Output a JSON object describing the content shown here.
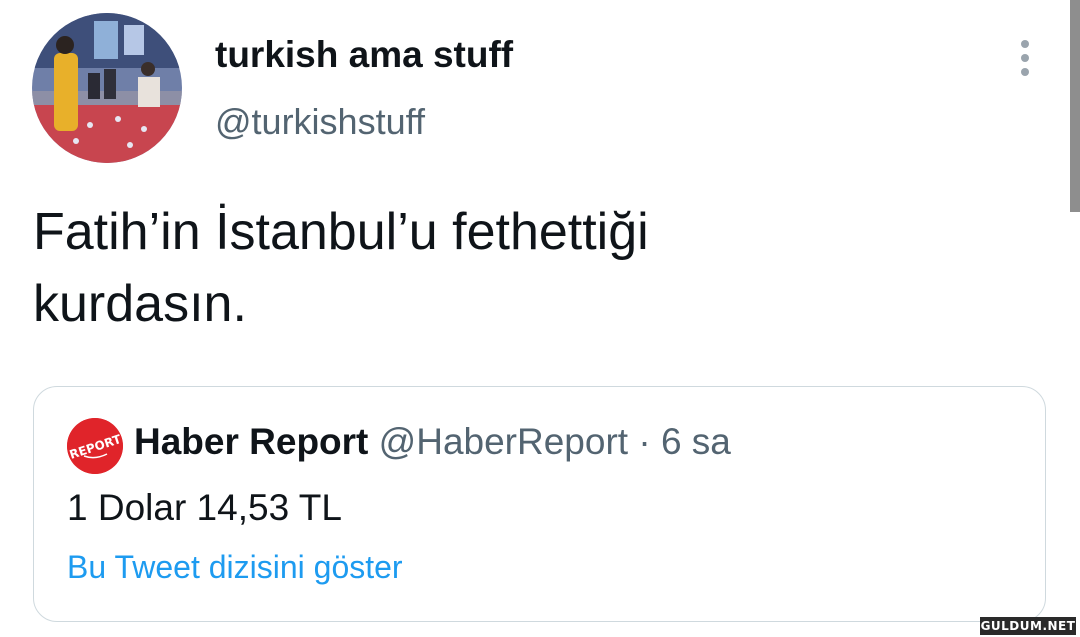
{
  "tweet": {
    "display_name": "turkish ama stuff",
    "handle": "@turkishstuff",
    "text_line1": "Fatih’in İstanbul’u fethettiği",
    "text_line2": "kurdasın."
  },
  "quote": {
    "name": "Haber Report",
    "handle": "@HaberReport",
    "separator": "·",
    "time": "6 sa",
    "text": "1 Dolar 14,53 TL",
    "show_thread_label": "Bu Tweet dizisini göster",
    "avatar_logo_text": "REPORT"
  },
  "watermark": {
    "text": "GULDUM.NET"
  },
  "colors": {
    "text_primary": "#0f1419",
    "text_secondary": "#536471",
    "link": "#1d9bf0",
    "border": "#cfd9de",
    "quote_avatar_red": "#e0242a"
  },
  "icons": {
    "more": "more-vertical-icon"
  }
}
